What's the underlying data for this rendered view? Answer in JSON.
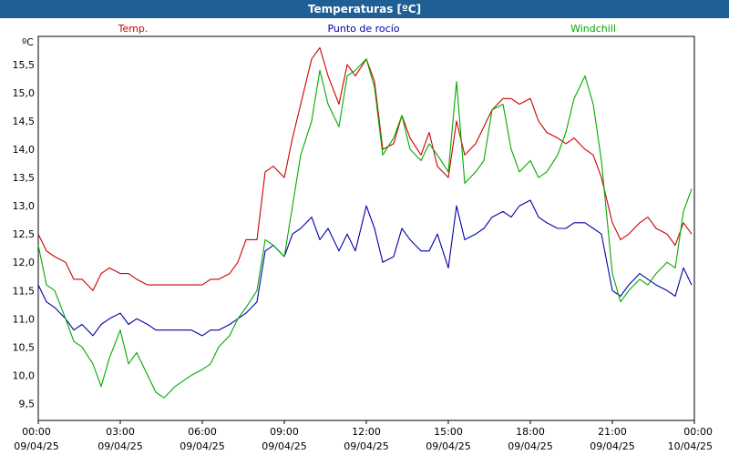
{
  "window": {
    "title": "Temperaturas [ºC]"
  },
  "chart_data": {
    "type": "line",
    "title": "Temperaturas [ºC]",
    "ylabel": "ºC",
    "ylim": [
      9.2,
      16.0
    ],
    "y_ticks": [
      "9,5",
      "10,0",
      "10,5",
      "11,0",
      "11,5",
      "12,0",
      "12,5",
      "13,0",
      "13,5",
      "14,0",
      "14,5",
      "15,0",
      "15,5"
    ],
    "y_tick_values": [
      9.5,
      10.0,
      10.5,
      11.0,
      11.5,
      12.0,
      12.5,
      13.0,
      13.5,
      14.0,
      14.5,
      15.0,
      15.5
    ],
    "x_ticks": [
      {
        "time": "00:00",
        "date": "09/04/25"
      },
      {
        "time": "03:00",
        "date": "09/04/25"
      },
      {
        "time": "06:00",
        "date": "09/04/25"
      },
      {
        "time": "09:00",
        "date": "09/04/25"
      },
      {
        "time": "12:00",
        "date": "09/04/25"
      },
      {
        "time": "15:00",
        "date": "09/04/25"
      },
      {
        "time": "18:00",
        "date": "09/04/25"
      },
      {
        "time": "21:00",
        "date": "09/04/25"
      },
      {
        "time": "00:00",
        "date": "10/04/25"
      }
    ],
    "x_range_hours": [
      0,
      24
    ],
    "grid": true,
    "grid_style": "dashed",
    "legend_placement": "top",
    "series": [
      {
        "name": "Temp.",
        "color": "#cc0000",
        "x": [
          0,
          0.3,
          0.6,
          1,
          1.3,
          1.6,
          2,
          2.3,
          2.6,
          3,
          3.3,
          3.6,
          4,
          4.3,
          4.6,
          5,
          5.3,
          5.6,
          6,
          6.3,
          6.6,
          7,
          7.3,
          7.6,
          8,
          8.3,
          8.6,
          9,
          9.3,
          9.6,
          10,
          10.3,
          10.6,
          11,
          11.3,
          11.6,
          12,
          12.3,
          12.6,
          13,
          13.3,
          13.6,
          14,
          14.3,
          14.6,
          15,
          15.3,
          15.6,
          16,
          16.3,
          16.6,
          17,
          17.3,
          17.6,
          18,
          18.3,
          18.6,
          19,
          19.3,
          19.6,
          20,
          20.3,
          20.6,
          21,
          21.3,
          21.6,
          22,
          22.3,
          22.6,
          23,
          23.3,
          23.6,
          23.9
        ],
        "y": [
          12.5,
          12.2,
          12.1,
          12.0,
          11.7,
          11.7,
          11.5,
          11.8,
          11.9,
          11.8,
          11.8,
          11.7,
          11.6,
          11.6,
          11.6,
          11.6,
          11.6,
          11.6,
          11.6,
          11.7,
          11.7,
          11.8,
          12.0,
          12.4,
          12.4,
          13.6,
          13.7,
          13.5,
          14.2,
          14.8,
          15.6,
          15.8,
          15.3,
          14.8,
          15.5,
          15.3,
          15.6,
          15.2,
          14.0,
          14.1,
          14.6,
          14.2,
          13.9,
          14.3,
          13.7,
          13.5,
          14.5,
          13.9,
          14.1,
          14.4,
          14.7,
          14.9,
          14.9,
          14.8,
          14.9,
          14.5,
          14.3,
          14.2,
          14.1,
          14.2,
          14.0,
          13.9,
          13.5,
          12.7,
          12.4,
          12.5,
          12.7,
          12.8,
          12.6,
          12.5,
          12.3,
          12.7,
          12.5
        ]
      },
      {
        "name": "Punto de rocío",
        "color": "#0000aa",
        "x": [
          0,
          0.3,
          0.6,
          1,
          1.3,
          1.6,
          2,
          2.3,
          2.6,
          3,
          3.3,
          3.6,
          4,
          4.3,
          4.6,
          5,
          5.3,
          5.6,
          6,
          6.3,
          6.6,
          7,
          7.3,
          7.6,
          8,
          8.3,
          8.6,
          9,
          9.3,
          9.6,
          10,
          10.3,
          10.6,
          11,
          11.3,
          11.6,
          12,
          12.3,
          12.6,
          13,
          13.3,
          13.6,
          14,
          14.3,
          14.6,
          15,
          15.3,
          15.6,
          16,
          16.3,
          16.6,
          17,
          17.3,
          17.6,
          18,
          18.3,
          18.6,
          19,
          19.3,
          19.6,
          20,
          20.3,
          20.6,
          21,
          21.3,
          21.6,
          22,
          22.3,
          22.6,
          23,
          23.3,
          23.6,
          23.9
        ],
        "y": [
          11.6,
          11.3,
          11.2,
          11.0,
          10.8,
          10.9,
          10.7,
          10.9,
          11.0,
          11.1,
          10.9,
          11.0,
          10.9,
          10.8,
          10.8,
          10.8,
          10.8,
          10.8,
          10.7,
          10.8,
          10.8,
          10.9,
          11.0,
          11.1,
          11.3,
          12.2,
          12.3,
          12.1,
          12.5,
          12.6,
          12.8,
          12.4,
          12.6,
          12.2,
          12.5,
          12.2,
          13.0,
          12.6,
          12.0,
          12.1,
          12.6,
          12.4,
          12.2,
          12.2,
          12.5,
          11.9,
          13.0,
          12.4,
          12.5,
          12.6,
          12.8,
          12.9,
          12.8,
          13.0,
          13.1,
          12.8,
          12.7,
          12.6,
          12.6,
          12.7,
          12.7,
          12.6,
          12.5,
          11.5,
          11.4,
          11.6,
          11.8,
          11.7,
          11.6,
          11.5,
          11.4,
          11.9,
          11.6
        ]
      },
      {
        "name": "Windchill",
        "color": "#00aa00",
        "x": [
          0,
          0.3,
          0.6,
          1,
          1.3,
          1.6,
          2,
          2.3,
          2.6,
          3,
          3.3,
          3.6,
          4,
          4.3,
          4.6,
          5,
          5.3,
          5.6,
          6,
          6.3,
          6.6,
          7,
          7.3,
          7.6,
          8,
          8.3,
          8.6,
          9,
          9.3,
          9.6,
          10,
          10.3,
          10.6,
          11,
          11.3,
          11.6,
          12,
          12.3,
          12.6,
          13,
          13.3,
          13.6,
          14,
          14.3,
          14.6,
          15,
          15.3,
          15.6,
          16,
          16.3,
          16.6,
          17,
          17.3,
          17.6,
          18,
          18.3,
          18.6,
          19,
          19.3,
          19.6,
          20,
          20.3,
          20.6,
          21,
          21.3,
          21.6,
          22,
          22.3,
          22.6,
          23,
          23.3,
          23.6,
          23.9
        ],
        "y": [
          12.3,
          11.6,
          11.5,
          11.0,
          10.6,
          10.5,
          10.2,
          9.8,
          10.3,
          10.8,
          10.2,
          10.4,
          10.0,
          9.7,
          9.6,
          9.8,
          9.9,
          10.0,
          10.1,
          10.2,
          10.5,
          10.7,
          11.0,
          11.2,
          11.5,
          12.4,
          12.3,
          12.1,
          13.0,
          13.9,
          14.5,
          15.4,
          14.8,
          14.4,
          15.3,
          15.4,
          15.6,
          15.1,
          13.9,
          14.2,
          14.6,
          14.0,
          13.8,
          14.1,
          13.9,
          13.6,
          15.2,
          13.4,
          13.6,
          13.8,
          14.7,
          14.8,
          14.0,
          13.6,
          13.8,
          13.5,
          13.6,
          13.9,
          14.3,
          14.9,
          15.3,
          14.8,
          13.8,
          11.8,
          11.3,
          11.5,
          11.7,
          11.6,
          11.8,
          12.0,
          11.9,
          12.9,
          13.3
        ]
      }
    ]
  }
}
